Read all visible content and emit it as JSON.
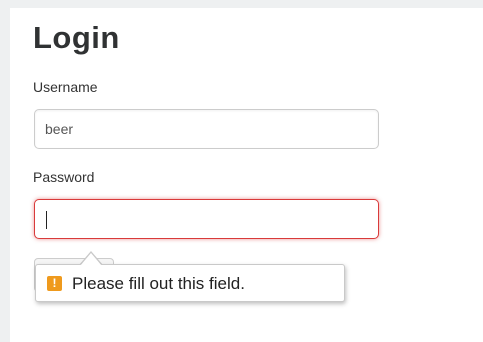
{
  "form": {
    "title": "Login",
    "username_label": "Username",
    "username_value": "beer",
    "password_label": "Password",
    "password_value": ""
  },
  "validation": {
    "icon": "warning-icon",
    "icon_glyph": "!",
    "icon_color": "#ef9a1d",
    "message": "Please fill out this field."
  },
  "colors": {
    "error_border": "#d93a3a",
    "background": "#eef0f1"
  }
}
